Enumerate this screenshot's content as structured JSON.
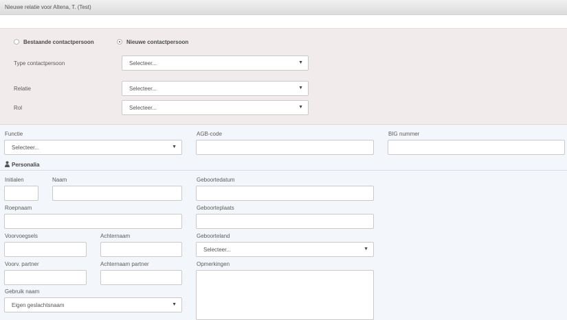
{
  "window": {
    "title": "Nieuwe relatie voor Altena, T. (Test)"
  },
  "contact_choice": {
    "existing_label": "Bestaande contactpersoon",
    "new_label": "Nieuwe contactpersoon",
    "selected": "new"
  },
  "type_contactpersoon": {
    "label": "Type contactpersoon",
    "value": "Selecteer..."
  },
  "relatie": {
    "label": "Relatie",
    "value": "Selecteer..."
  },
  "rol": {
    "label": "Rol",
    "value": "Selecteer..."
  },
  "functie": {
    "label": "Functie",
    "value": "Selecteer..."
  },
  "agb_code": {
    "label": "AGB-code",
    "value": ""
  },
  "big_nummer": {
    "label": "BIG nummer",
    "value": ""
  },
  "personalia": {
    "title": "Personalia",
    "icon": "person-icon"
  },
  "initialen": {
    "label": "Initialen",
    "value": ""
  },
  "naam": {
    "label": "Naam",
    "value": ""
  },
  "geboortedatum": {
    "label": "Geboortedatum",
    "value": ""
  },
  "roepnaam": {
    "label": "Roepnaam",
    "value": ""
  },
  "geboorteplaats": {
    "label": "Geboorteplaats",
    "value": ""
  },
  "voorvoegsels": {
    "label": "Voorvoegsels",
    "value": ""
  },
  "achternaam": {
    "label": "Achternaam",
    "value": ""
  },
  "geboorteland": {
    "label": "Geboorteland",
    "value": "Selecteer..."
  },
  "voorv_partner": {
    "label": "Voorv. partner",
    "value": ""
  },
  "achternaam_partner": {
    "label": "Achternaam partner",
    "value": ""
  },
  "opmerkingen": {
    "label": "Opmerkingen",
    "value": ""
  },
  "gebruik_naam": {
    "label": "Gebruik naam",
    "value": "Eigen geslachtsnaam"
  },
  "colors": {
    "pink_panel": "#f2ebec",
    "blue_panel": "#f3f6fa",
    "border": "#c9c9c9"
  }
}
